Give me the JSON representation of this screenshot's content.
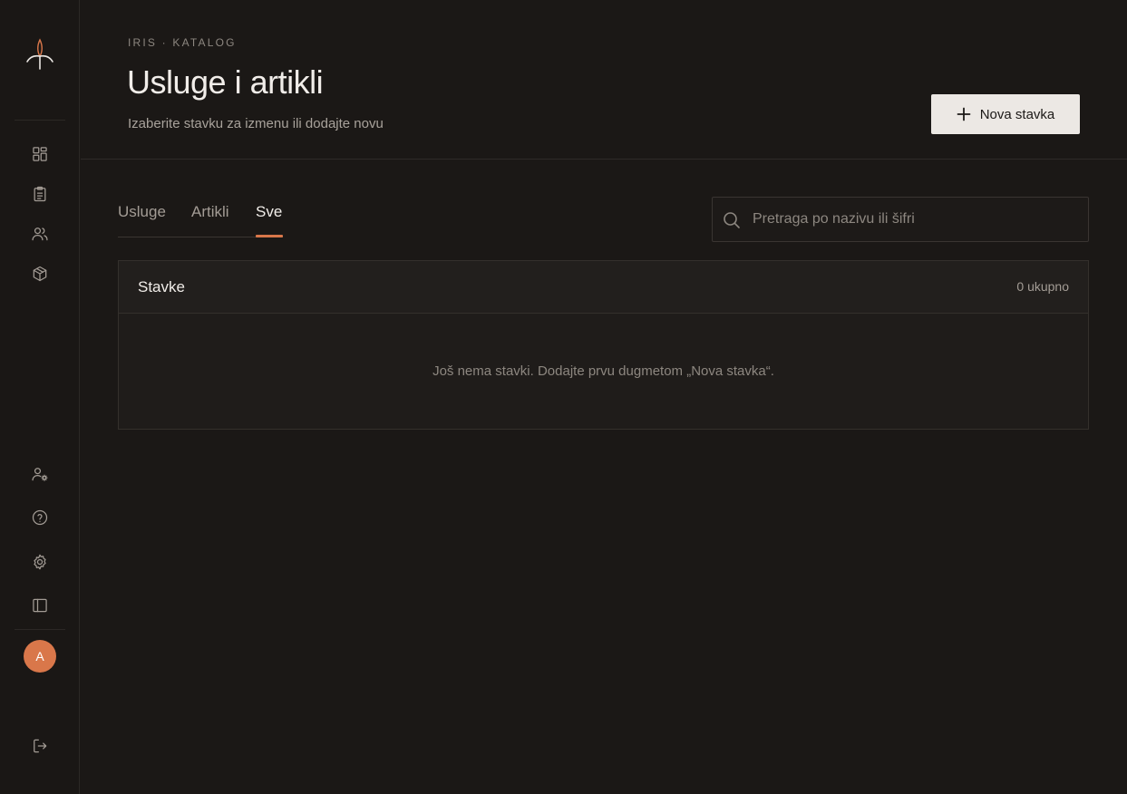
{
  "sidebar": {
    "logo_icon": "iris-flower-icon",
    "nav_items": [
      {
        "name": "dashboard",
        "icon": "grid-icon"
      },
      {
        "name": "orders",
        "icon": "clipboard-icon"
      },
      {
        "name": "clients",
        "icon": "users-icon"
      },
      {
        "name": "catalog",
        "icon": "package-icon"
      }
    ],
    "bottom_items": [
      {
        "name": "user-settings",
        "icon": "user-gear-icon"
      },
      {
        "name": "help",
        "icon": "help-circle-icon"
      },
      {
        "name": "settings",
        "icon": "gear-icon"
      },
      {
        "name": "toggle-sidebar",
        "icon": "sidebar-icon"
      }
    ],
    "avatar_initial": "A",
    "logout_icon": "logout-icon"
  },
  "header": {
    "eyebrow": "IRIS · KATALOG",
    "title": "Usluge i artikli",
    "subtitle": "Izaberite stavku za izmenu ili dodajte novu",
    "new_button_label": "Nova stavka"
  },
  "tabs": [
    {
      "label": "Usluge",
      "active": false
    },
    {
      "label": "Artikli",
      "active": false
    },
    {
      "label": "Sve",
      "active": true
    }
  ],
  "search": {
    "placeholder": "Pretraga po nazivu ili šifri",
    "value": ""
  },
  "items_card": {
    "title": "Stavke",
    "count_label": "0 ukupno",
    "empty_message": "Još nema stavki. Dodajte prvu dugmetom „Nova stavka“."
  },
  "colors": {
    "accent": "#d9774a",
    "background": "#1b1816",
    "primary_button": "#ece8e4"
  }
}
